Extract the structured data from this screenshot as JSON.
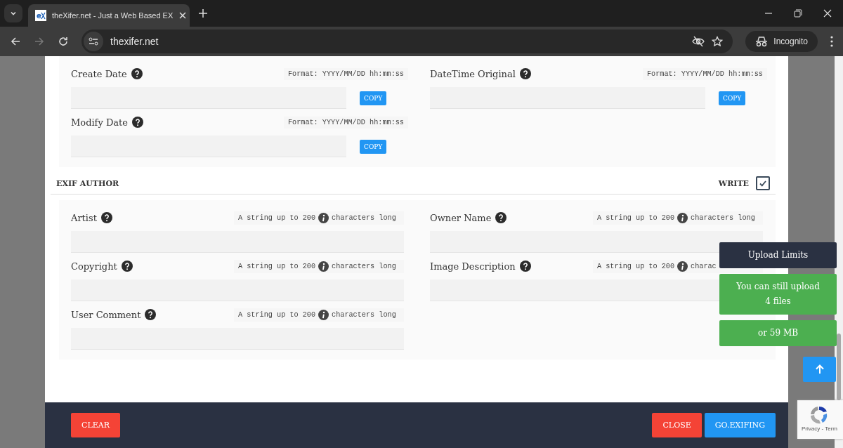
{
  "browser": {
    "tab_title": "theXifer.net - Just a Web Based EX",
    "url": "thexifer.net",
    "profile": "Incognito"
  },
  "date_fields": [
    {
      "label": "Create Date",
      "hint": "Format: YYYY/MM/DD hh:mm:ss",
      "button": "COPY"
    },
    {
      "label": "DateTime Original",
      "hint": "Format: YYYY/MM/DD hh:mm:ss",
      "button": "COPY"
    },
    {
      "label": "Modify Date",
      "hint": "Format: YYYY/MM/DD hh:mm:ss",
      "button": "COPY"
    }
  ],
  "author_section": {
    "title": "EXIF AUTHOR",
    "write_label": "WRITE",
    "write_checked": true,
    "fields": [
      {
        "label": "Artist",
        "hint_before": "A string up to 200",
        "hint_after": "characters long"
      },
      {
        "label": "Owner Name",
        "hint_before": "A string up to 200",
        "hint_after": "characters long"
      },
      {
        "label": "Copyright",
        "hint_before": "A string up to 200",
        "hint_after": "characters long"
      },
      {
        "label": "Image Description",
        "hint_before": "A string up to 200",
        "hint_after": "charac"
      },
      {
        "label": "User Comment",
        "hint_before": "A string up to 200",
        "hint_after": "characters long"
      }
    ]
  },
  "upload_limits": {
    "title": "Upload Limits",
    "files_text": "You can still upload 4 files",
    "size_text": "or 59 MB"
  },
  "footer": {
    "buttons": [
      {
        "label": "CLEAR",
        "kind": "danger"
      },
      {
        "label": "CLOSE",
        "kind": "danger"
      },
      {
        "label": "GO.EXIFING",
        "kind": "primary"
      }
    ]
  },
  "recaptcha": {
    "text": "Privacy - Term"
  }
}
